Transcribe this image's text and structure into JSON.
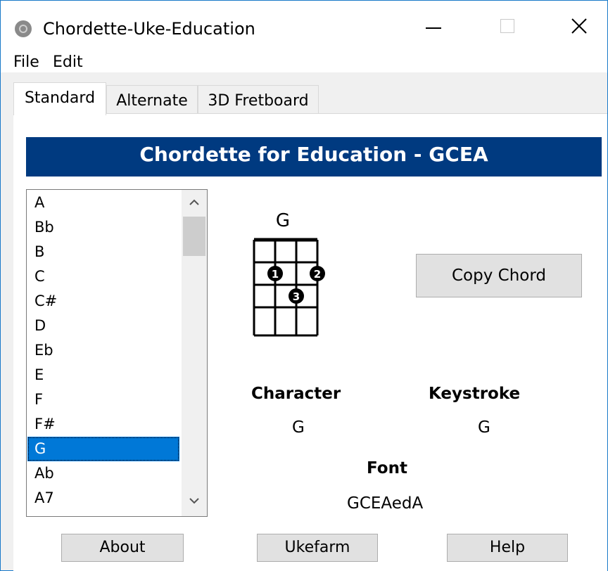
{
  "window": {
    "title": "Chordette-Uke-Education",
    "controls": {
      "minimize_icon": "minimize-icon",
      "maximize_icon": "maximize-icon",
      "close_icon": "close-icon"
    }
  },
  "menu": {
    "file": "File",
    "edit": "Edit"
  },
  "tabs": [
    {
      "label": "Standard",
      "selected": true
    },
    {
      "label": "Alternate",
      "selected": false
    },
    {
      "label": "3D Fretboard",
      "selected": false
    }
  ],
  "banner": {
    "title": "Chordette for Education - GCEA",
    "color": "#003a80"
  },
  "chord_list": {
    "items": [
      "A",
      "Bb",
      "B",
      "C",
      "C#",
      "D",
      "Eb",
      "E",
      "F",
      "F#",
      "G",
      "Ab",
      "A7"
    ],
    "selected": "G",
    "selected_color": "#0078d7"
  },
  "chord_diagram": {
    "name": "G",
    "fingers": [
      {
        "label": "1",
        "string": 2,
        "fret": 2
      },
      {
        "label": "2",
        "string": 4,
        "fret": 2
      },
      {
        "label": "3",
        "string": 3,
        "fret": 3
      }
    ]
  },
  "copy_button": "Copy Chord",
  "info": {
    "character_label": "Character",
    "character_value": "G",
    "keystroke_label": "Keystroke",
    "keystroke_value": "G",
    "font_label": "Font",
    "font_value": "GCEAedA"
  },
  "buttons": {
    "about": "About",
    "ukefarm": "Ukefarm",
    "help": "Help"
  }
}
